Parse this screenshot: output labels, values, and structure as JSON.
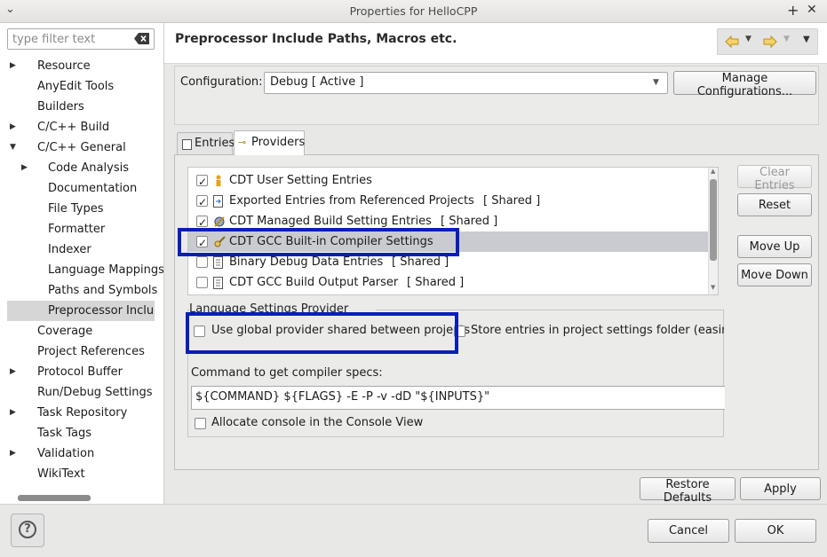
{
  "window": {
    "title": "Properties for HelloCPP"
  },
  "filter": {
    "placeholder": "type filter text"
  },
  "tree": [
    {
      "label": "Resource",
      "arrow": "▶",
      "indent": 0
    },
    {
      "label": "AnyEdit Tools",
      "arrow": "",
      "indent": 0
    },
    {
      "label": "Builders",
      "arrow": "",
      "indent": 0
    },
    {
      "label": "C/C++ Build",
      "arrow": "▶",
      "indent": 0
    },
    {
      "label": "C/C++ General",
      "arrow": "▼",
      "indent": 0
    },
    {
      "label": "Code Analysis",
      "arrow": "▶",
      "indent": 1
    },
    {
      "label": "Documentation",
      "arrow": "",
      "indent": 1
    },
    {
      "label": "File Types",
      "arrow": "",
      "indent": 1
    },
    {
      "label": "Formatter",
      "arrow": "",
      "indent": 1
    },
    {
      "label": "Indexer",
      "arrow": "",
      "indent": 1
    },
    {
      "label": "Language Mappings",
      "arrow": "",
      "indent": 1
    },
    {
      "label": "Paths and Symbols",
      "arrow": "",
      "indent": 1
    },
    {
      "label": "Preprocessor Includ",
      "arrow": "",
      "indent": 1,
      "selected": true
    },
    {
      "label": "Coverage",
      "arrow": "",
      "indent": 0
    },
    {
      "label": "Project References",
      "arrow": "",
      "indent": 0
    },
    {
      "label": "Protocol Buffer",
      "arrow": "▶",
      "indent": 0
    },
    {
      "label": "Run/Debug Settings",
      "arrow": "",
      "indent": 0
    },
    {
      "label": "Task Repository",
      "arrow": "▶",
      "indent": 0
    },
    {
      "label": "Task Tags",
      "arrow": "",
      "indent": 0
    },
    {
      "label": "Validation",
      "arrow": "▶",
      "indent": 0
    },
    {
      "label": "WikiText",
      "arrow": "",
      "indent": 0
    }
  ],
  "header": {
    "title": "Preprocessor Include Paths, Macros etc."
  },
  "config": {
    "label": "Configuration:",
    "value": "Debug  [ Active ]",
    "manage_label": "Manage Configurations..."
  },
  "tabs": [
    {
      "label": "Entries",
      "active": false
    },
    {
      "label": "Providers",
      "active": true
    }
  ],
  "providers": [
    {
      "label": "CDT User Setting Entries",
      "shared": "",
      "checked": true,
      "icon": "person-icon",
      "selected": false
    },
    {
      "label": "Exported Entries from Referenced Projects",
      "shared": "[ Shared ]",
      "checked": true,
      "icon": "exported-entries-icon",
      "selected": false
    },
    {
      "label": "CDT Managed Build Setting Entries",
      "shared": "[ Shared ]",
      "checked": true,
      "icon": "build-settings-icon",
      "selected": false
    },
    {
      "label": "CDT GCC Built-in Compiler Settings",
      "shared": "",
      "checked": true,
      "icon": "compiler-icon",
      "selected": true
    },
    {
      "label": "Binary Debug Data Entries",
      "shared": "[ Shared ]",
      "checked": false,
      "icon": "document-icon",
      "selected": false
    },
    {
      "label": "CDT GCC Build Output Parser",
      "shared": "[ Shared ]",
      "checked": false,
      "icon": "document-icon",
      "selected": false
    }
  ],
  "side_buttons": {
    "clear": "Clear Entries",
    "reset": "Reset",
    "move_up": "Move Up",
    "move_down": "Move Down"
  },
  "options": {
    "group_label": "Language Settings Provider Options",
    "use_global": "Use global provider shared between projects",
    "store_entries": "Store entries in project settings folder (easing pr",
    "command_label": "Command to get compiler specs:",
    "command_value": "${COMMAND} ${FLAGS} -E -P -v -dD \"${INPUTS}\"",
    "allocate_console": "Allocate console in the Console View"
  },
  "footer": {
    "restore_defaults": "Restore Defaults",
    "apply": "Apply",
    "cancel": "Cancel",
    "ok": "OK"
  },
  "colors": {
    "highlight": "#0a1fb8",
    "selection": "#c9cbd1"
  }
}
